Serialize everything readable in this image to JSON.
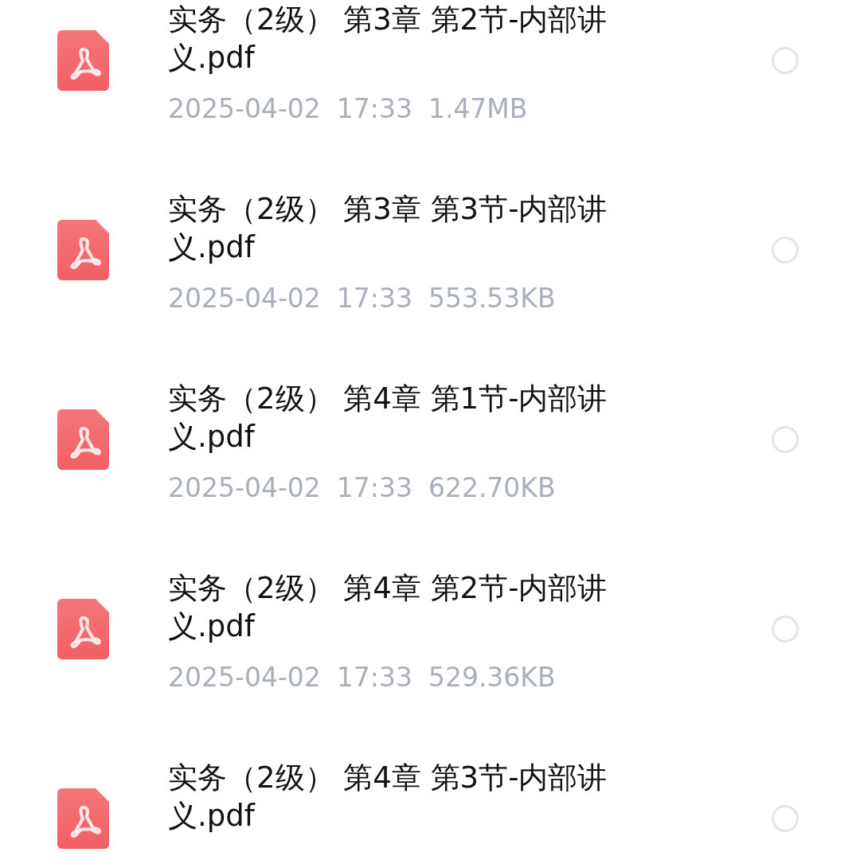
{
  "files": [
    {
      "name": "实务（2级） 第3章 第2节-内部讲义.pdf",
      "date": "2025-04-02",
      "time": "17:33",
      "size": "1.47MB",
      "selected": false
    },
    {
      "name": "实务（2级） 第3章 第3节-内部讲义.pdf",
      "date": "2025-04-02",
      "time": "17:33",
      "size": "553.53KB",
      "selected": false
    },
    {
      "name": "实务（2级） 第4章 第1节-内部讲义.pdf",
      "date": "2025-04-02",
      "time": "17:33",
      "size": "622.70KB",
      "selected": false
    },
    {
      "name": "实务（2级） 第4章 第2节-内部讲义.pdf",
      "date": "2025-04-02",
      "time": "17:33",
      "size": "529.36KB",
      "selected": false
    },
    {
      "name": "实务（2级） 第4章 第3节-内部讲义.pdf",
      "selected": false
    }
  ]
}
